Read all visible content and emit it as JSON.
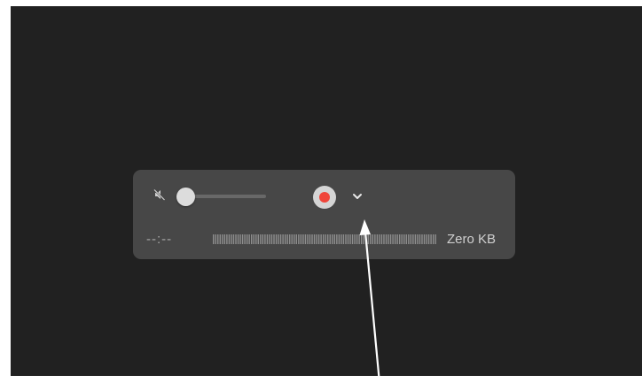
{
  "recorder": {
    "time": "--:--",
    "file_size": "Zero KB",
    "volume_level": 0,
    "muted": true,
    "level_meter_segments": 100
  },
  "colors": {
    "background": "#212121",
    "panel": "#474747",
    "record_dot": "#f0453a",
    "record_ring": "#d5d5d5",
    "text_dim": "#a8a8a8",
    "text": "#cfcfcf"
  },
  "icons": {
    "mute": "speaker-muted-icon",
    "record": "record-icon",
    "options": "chevron-down-icon",
    "annotation": "arrow-pointer"
  }
}
